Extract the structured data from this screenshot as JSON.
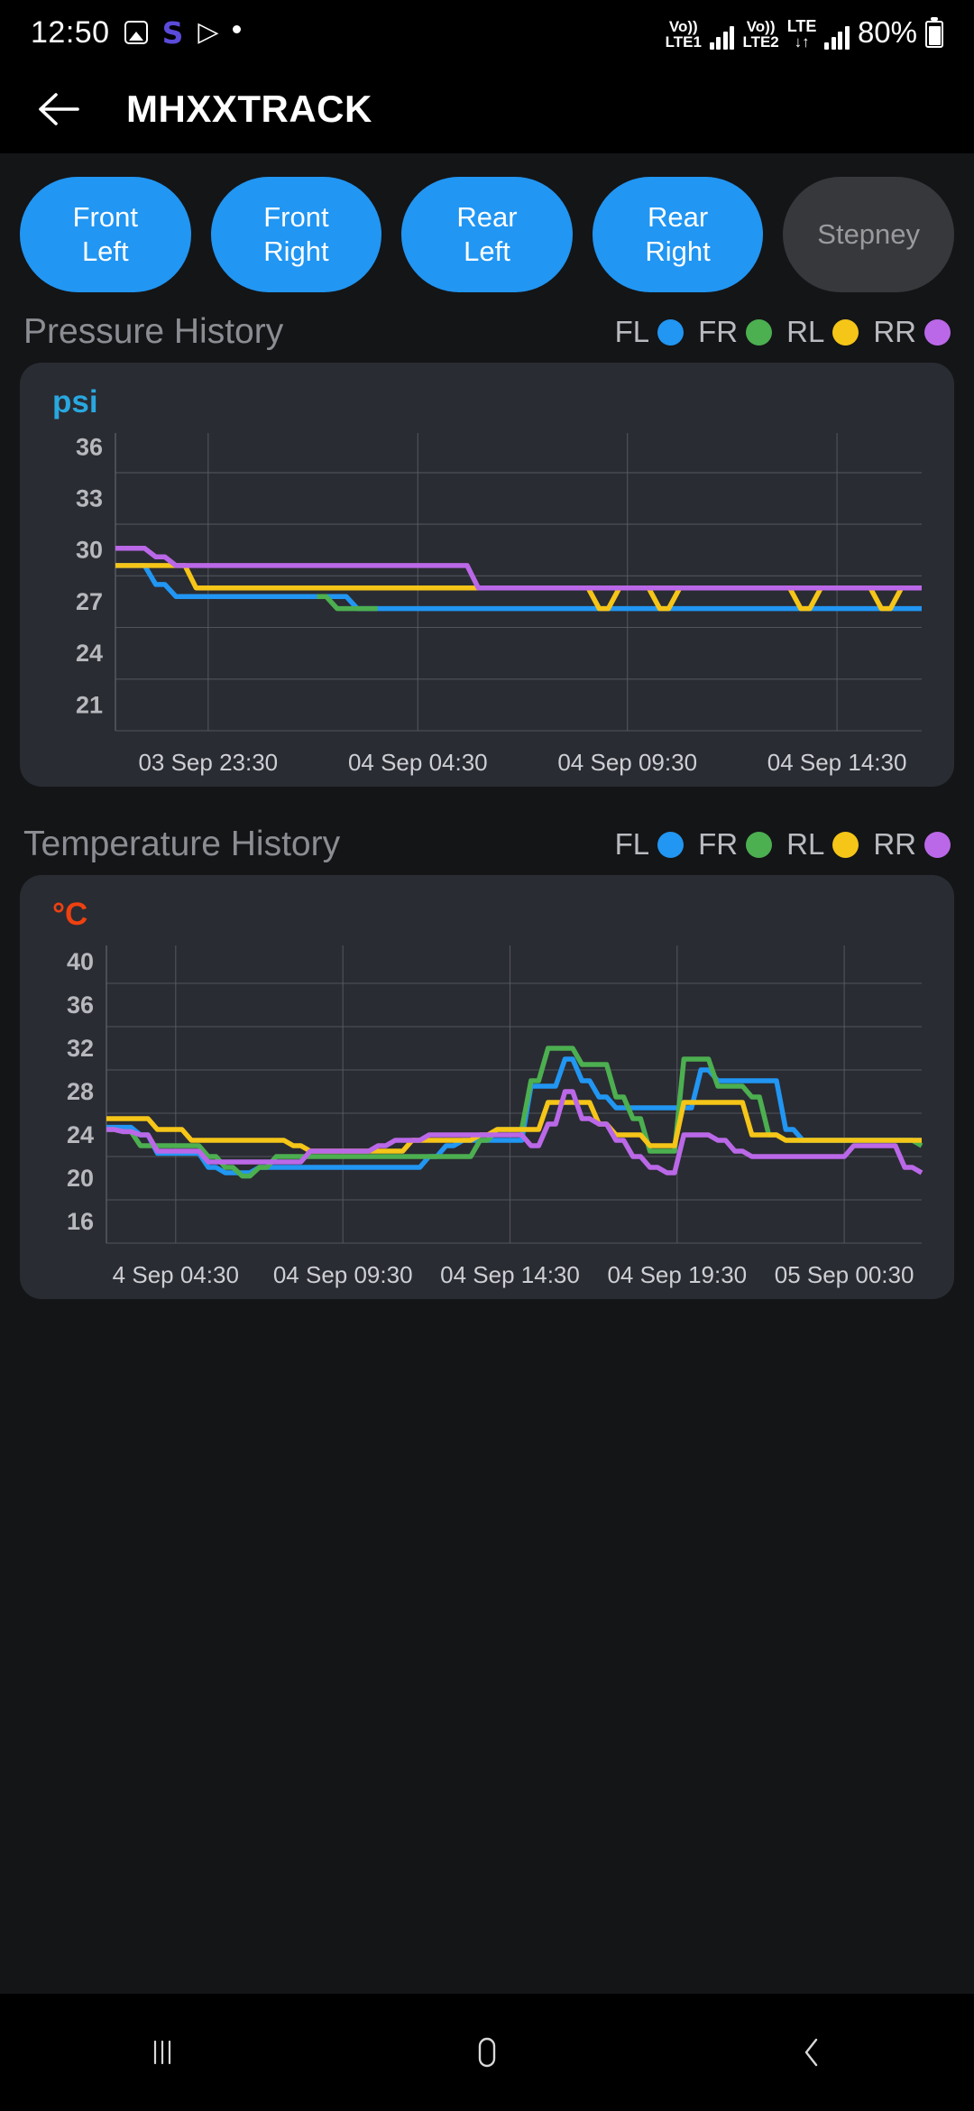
{
  "status_bar": {
    "clock": "12:50",
    "icons": [
      "photo-icon",
      "samsung-s-icon",
      "play-store-icon",
      "dot-icon"
    ],
    "network_1": {
      "volte": "Vo))",
      "label": "LTE1"
    },
    "network_2": {
      "volte": "Vo))",
      "label": "LTE2"
    },
    "lte": {
      "label": "LTE",
      "arrows": "↓↑"
    },
    "battery_percent": "80%"
  },
  "app_bar": {
    "back_icon": "back-arrow-icon",
    "title": "MHXXTRACK"
  },
  "tire_chips": [
    {
      "id": "front-left",
      "line1": "Front",
      "line2": "Left",
      "active": true
    },
    {
      "id": "front-right",
      "line1": "Front",
      "line2": "Right",
      "active": true
    },
    {
      "id": "rear-left",
      "line1": "Rear",
      "line2": "Left",
      "active": true
    },
    {
      "id": "rear-right",
      "line1": "Rear",
      "line2": "Right",
      "active": true
    },
    {
      "id": "stepney",
      "line1": "Stepney",
      "line2": "",
      "active": false
    }
  ],
  "colors": {
    "fl": "#2196f3",
    "fr": "#4caf50",
    "rl": "#f5c518",
    "rr": "#ba68e8",
    "accent_psi": "#29a8e0",
    "accent_c": "#ef4110",
    "card_bg": "#2a2c33",
    "page_bg": "#141517",
    "chip_on": "#2196f3",
    "chip_off": "#36383c",
    "grid": "#5d6068"
  },
  "legend": [
    {
      "label": "FL",
      "color": "#2196f3"
    },
    {
      "label": "FR",
      "color": "#4caf50"
    },
    {
      "label": "RL",
      "color": "#f5c518"
    },
    {
      "label": "RR",
      "color": "#ba68e8"
    }
  ],
  "pressure_section": {
    "title": "Pressure History",
    "unit": "psi"
  },
  "temperature_section": {
    "title": "Temperature History",
    "unit": "°C"
  },
  "nav_bar": {
    "recents": "recents-icon",
    "home": "home-icon",
    "back": "back-icon"
  },
  "chart_data": [
    {
      "id": "pressure-history",
      "type": "line",
      "title": "Pressure History",
      "ylabel": "psi",
      "xlabel": "",
      "ylim": [
        19.5,
        36.8
      ],
      "yticks": [
        21,
        24,
        27,
        30,
        33,
        36
      ],
      "xticks": [
        "03 Sep 23:30",
        "04 Sep 04:30",
        "04 Sep 09:30",
        "04 Sep 14:30"
      ],
      "xtick_positions": [
        0.115,
        0.375,
        0.635,
        0.895
      ],
      "grid": true,
      "legend_position": "top-right",
      "x": [
        0,
        1,
        2,
        3,
        4,
        5,
        6,
        7,
        8,
        9,
        10,
        11,
        12,
        13,
        14,
        15,
        16,
        17,
        18,
        19,
        20,
        21,
        22,
        23,
        24,
        25,
        26,
        27,
        28,
        29,
        30,
        31,
        32,
        33,
        34,
        35,
        36,
        37,
        38,
        39,
        40
      ],
      "series": [
        {
          "name": "FL",
          "color": "#2196f3",
          "values": [
            29.1,
            29.1,
            28.0,
            27.3,
            27.3,
            27.3,
            27.3,
            27.3,
            27.3,
            27.3,
            27.3,
            27.3,
            26.6,
            26.6,
            26.6,
            26.6,
            26.6,
            26.6,
            26.6,
            26.6,
            26.6,
            26.6,
            26.6,
            26.6,
            26.6,
            26.6,
            26.6,
            26.6,
            26.6,
            26.6,
            26.6,
            26.6,
            26.6,
            26.6,
            26.6,
            26.6,
            26.6,
            26.6,
            26.6,
            26.6,
            26.6
          ]
        },
        {
          "name": "FR",
          "color": "#4caf50",
          "values": [
            null,
            null,
            null,
            null,
            null,
            null,
            null,
            null,
            null,
            null,
            27.3,
            26.6,
            26.6,
            26.6,
            null,
            null,
            null,
            null,
            null,
            null,
            null,
            null,
            null,
            null,
            null,
            null,
            null,
            null,
            null,
            null,
            null,
            null,
            null,
            null,
            null,
            null,
            null,
            null,
            null,
            null,
            null
          ]
        },
        {
          "name": "RL",
          "color": "#f5c518",
          "values": [
            29.1,
            29.1,
            29.1,
            29.1,
            27.8,
            27.8,
            27.8,
            27.8,
            27.8,
            27.8,
            27.8,
            27.8,
            27.8,
            27.8,
            27.8,
            27.8,
            27.8,
            27.8,
            27.8,
            27.8,
            27.8,
            27.8,
            27.8,
            27.8,
            26.6,
            27.8,
            27.8,
            26.6,
            27.8,
            27.8,
            27.8,
            27.8,
            27.8,
            27.8,
            26.6,
            27.8,
            27.8,
            27.8,
            26.6,
            27.8,
            27.8
          ]
        },
        {
          "name": "RR",
          "color": "#ba68e8",
          "values": [
            30.1,
            30.1,
            29.6,
            29.1,
            29.1,
            29.1,
            29.1,
            29.1,
            29.1,
            29.1,
            29.1,
            29.1,
            29.1,
            29.1,
            29.1,
            29.1,
            29.1,
            29.1,
            27.8,
            27.8,
            27.8,
            27.8,
            27.8,
            27.8,
            27.8,
            27.8,
            27.8,
            27.8,
            27.8,
            27.8,
            27.8,
            27.8,
            27.8,
            27.8,
            27.8,
            27.8,
            27.8,
            27.8,
            27.8,
            27.8,
            27.8
          ]
        }
      ]
    },
    {
      "id": "temperature-history",
      "type": "line",
      "title": "Temperature History",
      "ylabel": "°C",
      "xlabel": "",
      "ylim": [
        14.0,
        41.5
      ],
      "yticks": [
        16,
        20,
        24,
        28,
        32,
        36,
        40
      ],
      "xticks": [
        "4 Sep 04:30",
        "04 Sep 09:30",
        "04 Sep 14:30",
        "04 Sep 19:30",
        "05 Sep 00:30"
      ],
      "xtick_positions": [
        0.085,
        0.29,
        0.495,
        0.7,
        0.905
      ],
      "grid": true,
      "legend_position": "top-right",
      "x": [
        0,
        1,
        2,
        3,
        4,
        5,
        6,
        7,
        8,
        9,
        10,
        11,
        12,
        13,
        14,
        15,
        16,
        17,
        18,
        19,
        20,
        21,
        22,
        23,
        24,
        25,
        26,
        27,
        28,
        29,
        30,
        31,
        32,
        33,
        34,
        35,
        36,
        37,
        38,
        39,
        40,
        41,
        42,
        43,
        44,
        45,
        46,
        47,
        48
      ],
      "series": [
        {
          "name": "FL",
          "color": "#2196f3",
          "values": [
            24.7,
            24.7,
            24.0,
            22.3,
            22.3,
            22.3,
            21.0,
            20.5,
            20.5,
            21.0,
            21.0,
            21.0,
            21.0,
            21.0,
            21.0,
            21.0,
            21.0,
            21.0,
            21.0,
            22.0,
            23.0,
            23.5,
            23.5,
            23.5,
            23.5,
            28.5,
            28.5,
            31.0,
            29.0,
            27.5,
            26.5,
            26.5,
            26.5,
            26.5,
            26.5,
            30.0,
            29.0,
            29.0,
            29.0,
            29.0,
            24.5,
            23.5,
            23.5,
            23.5,
            23.5,
            23.5,
            23.5,
            23.5,
            23.5
          ]
        },
        {
          "name": "FR",
          "color": "#4caf50",
          "values": [
            24.5,
            24.3,
            23.0,
            23.0,
            23.0,
            23.0,
            22.0,
            21.0,
            20.2,
            21.0,
            22.0,
            22.0,
            22.0,
            22.0,
            22.0,
            22.0,
            22.0,
            22.0,
            22.0,
            22.0,
            22.0,
            22.0,
            23.5,
            24.5,
            24.5,
            29.0,
            32.0,
            32.0,
            30.5,
            30.5,
            27.5,
            25.5,
            22.5,
            22.5,
            31.0,
            31.0,
            28.5,
            28.5,
            27.5,
            24.0,
            23.5,
            23.5,
            23.5,
            23.5,
            23.5,
            23.5,
            23.5,
            23.5,
            23.0
          ]
        },
        {
          "name": "RL",
          "color": "#f5c518",
          "values": [
            25.5,
            25.5,
            25.5,
            24.5,
            24.5,
            23.5,
            23.5,
            23.5,
            23.5,
            23.5,
            23.5,
            23.0,
            22.5,
            22.5,
            22.5,
            22.5,
            22.5,
            22.5,
            23.5,
            23.5,
            23.5,
            23.5,
            24.0,
            24.5,
            24.5,
            24.5,
            27.0,
            27.0,
            27.0,
            25.0,
            24.0,
            24.0,
            23.0,
            23.0,
            27.0,
            27.0,
            27.0,
            27.0,
            24.0,
            24.0,
            23.5,
            23.5,
            23.5,
            23.5,
            23.5,
            23.5,
            23.5,
            23.5,
            23.5
          ]
        },
        {
          "name": "RR",
          "color": "#ba68e8",
          "values": [
            24.5,
            24.3,
            24.0,
            22.5,
            22.5,
            22.5,
            21.5,
            21.5,
            21.5,
            21.5,
            21.5,
            21.5,
            22.5,
            22.5,
            22.5,
            22.5,
            23.0,
            23.5,
            23.5,
            24.0,
            24.0,
            24.0,
            24.0,
            24.0,
            24.0,
            23.0,
            25.0,
            28.0,
            25.5,
            25.0,
            23.5,
            22.0,
            21.0,
            20.5,
            24.0,
            24.0,
            23.5,
            22.5,
            22.0,
            22.0,
            22.0,
            22.0,
            22.0,
            22.0,
            23.0,
            23.0,
            23.0,
            21.0,
            20.5
          ]
        }
      ]
    }
  ]
}
